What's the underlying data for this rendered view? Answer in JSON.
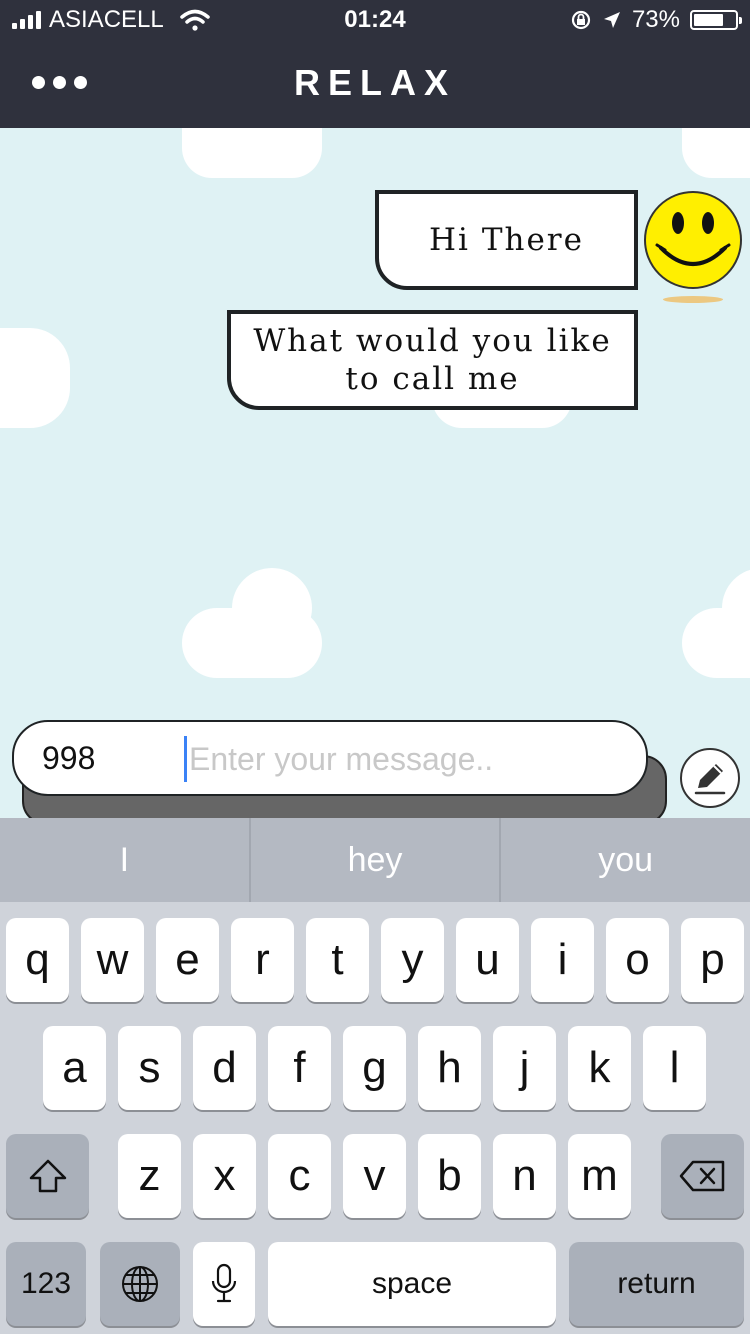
{
  "status_bar": {
    "carrier": "ASIACELL",
    "time": "01:24",
    "battery_percent": "73%",
    "battery_level": 0.73
  },
  "nav": {
    "title": "RELAX",
    "menu_icon": "more-dots-icon"
  },
  "chat": {
    "messages": [
      {
        "text": "Hi There"
      },
      {
        "text": "What would you like to call me"
      }
    ],
    "avatar_icon": "smiley-face-icon"
  },
  "composer": {
    "value": "998",
    "placeholder": "Enter your message..",
    "edit_icon": "pencil-icon"
  },
  "keyboard": {
    "suggestions": [
      "I",
      "hey",
      "you"
    ],
    "row1": [
      "q",
      "w",
      "e",
      "r",
      "t",
      "y",
      "u",
      "i",
      "o",
      "p"
    ],
    "row2": [
      "a",
      "s",
      "d",
      "f",
      "g",
      "h",
      "j",
      "k",
      "l"
    ],
    "row3": [
      "z",
      "x",
      "c",
      "v",
      "b",
      "n",
      "m"
    ],
    "numbers_label": "123",
    "space_label": "space",
    "return_label": "return",
    "shift_icon": "shift-arrow-icon",
    "delete_icon": "backspace-icon",
    "globe_icon": "globe-icon",
    "mic_icon": "microphone-icon"
  },
  "colors": {
    "header_bg": "#2f313d",
    "chat_bg": "#dff2f4",
    "smiley": "#ffef00",
    "keyboard_bg": "#cfd3da"
  }
}
